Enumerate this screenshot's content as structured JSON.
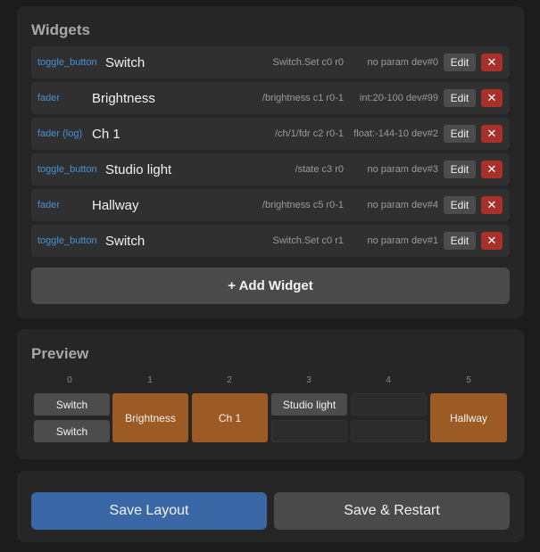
{
  "widgets_panel": {
    "title": "Widgets",
    "rows": [
      {
        "type": "toggle_button",
        "name": "Switch",
        "address": "Switch.Set  c0  r0",
        "param": "no param  dev#0"
      },
      {
        "type": "fader",
        "name": "Brightness",
        "address": "/brightness  c1  r0-1",
        "param": "int:20-100  dev#99"
      },
      {
        "type": "fader (log)",
        "name": "Ch 1",
        "address": "/ch/1/fdr  c2  r0-1",
        "param": "float:-144-10  dev#2"
      },
      {
        "type": "toggle_button",
        "name": "Studio light",
        "address": "/state  c3  r0",
        "param": "no param  dev#3"
      },
      {
        "type": "fader",
        "name": "Hallway",
        "address": "/brightness  c5  r0-1",
        "param": "no param  dev#4"
      },
      {
        "type": "toggle_button",
        "name": "Switch",
        "address": "Switch.Set  c0  r1",
        "param": "no param  dev#1"
      }
    ],
    "edit_label": "Edit",
    "delete_label": "✕",
    "add_label": "+ Add Widget"
  },
  "preview_panel": {
    "title": "Preview",
    "columns": [
      "0",
      "1",
      "2",
      "3",
      "4",
      "5"
    ],
    "cells": {
      "c0r0": "Switch",
      "c0r1": "Switch",
      "c1": "Brightness",
      "c2": "Ch 1",
      "c3r0": "Studio light",
      "c5": "Hallway"
    }
  },
  "actions": {
    "save_label": "Save Layout",
    "restart_label": "Save & Restart"
  },
  "colors": {
    "accent_blue": "#3a68a6",
    "fader_orange": "#9c5a24",
    "delete_red": "#a8302a",
    "type_blue": "#4a90d9"
  }
}
